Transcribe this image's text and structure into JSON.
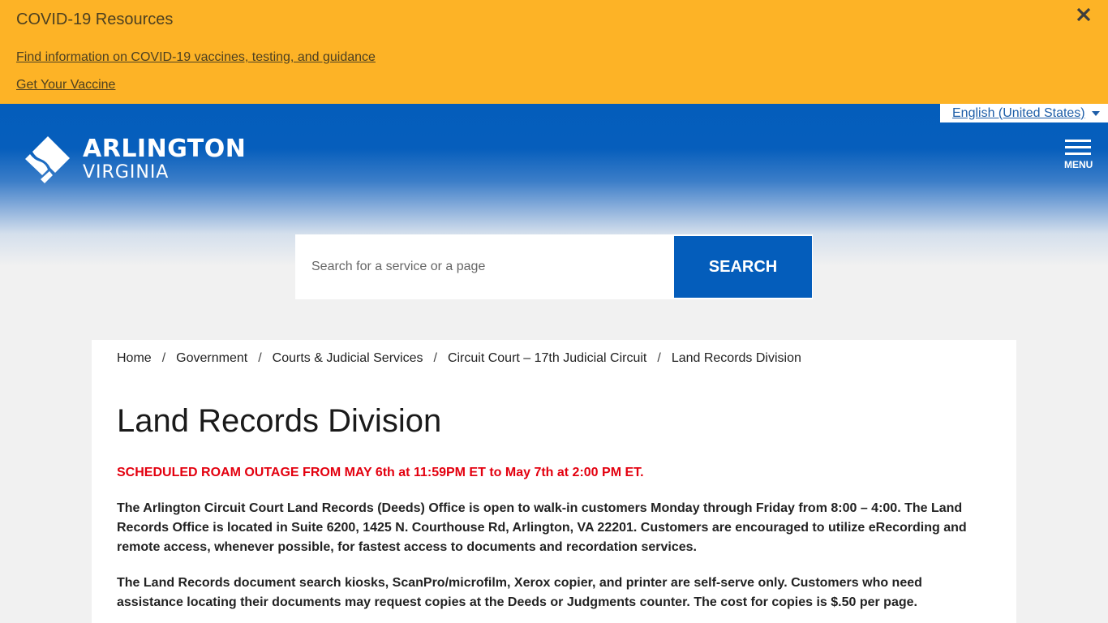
{
  "alert": {
    "title": "COVID-19 Resources",
    "link1": "Find information on COVID-19 vaccines, testing, and guidance",
    "link1_suffix": ".",
    "link2": "Get Your Vaccine",
    "close_icon": "close-icon",
    "background": "#fdb326"
  },
  "header": {
    "language": "English (United States)",
    "logo_line1": "ARLINGTON",
    "logo_line2": "VIRGINIA",
    "menu_label": "MENU",
    "brand_color": "#045dbb"
  },
  "search": {
    "placeholder": "Search for a service or a page",
    "value": "",
    "button_label": "SEARCH"
  },
  "breadcrumb": {
    "items": [
      "Home",
      "Government",
      "Courts & Judicial Services",
      "Circuit Court – 17th Judicial Circuit",
      "Land Records Division"
    ],
    "separator": "/"
  },
  "main": {
    "title": "Land Records Division",
    "outage_notice": "SCHEDULED ROAM OUTAGE FROM MAY 6th at 11:59PM ET to May 7th at 2:00 PM ET.",
    "outage_color": "#e3000f",
    "paragraphs": [
      "The Arlington Circuit Court Land Records (Deeds) Office is open to walk-in customers Monday through Friday from 8:00 – 4:00. The Land Records Office is located in Suite 6200, 1425 N. Courthouse Rd, Arlington, VA 22201. Customers are encouraged to utilize eRecording and remote access, whenever possible, for fastest access to documents and recordation services.",
      "The Land Records document search kiosks, ScanPro/microfilm, Xerox copier, and printer are self-serve only. Customers who  need assistance locating their documents may request copies at the Deeds or Judgments counter. The cost for copies is $.50 per page."
    ]
  }
}
